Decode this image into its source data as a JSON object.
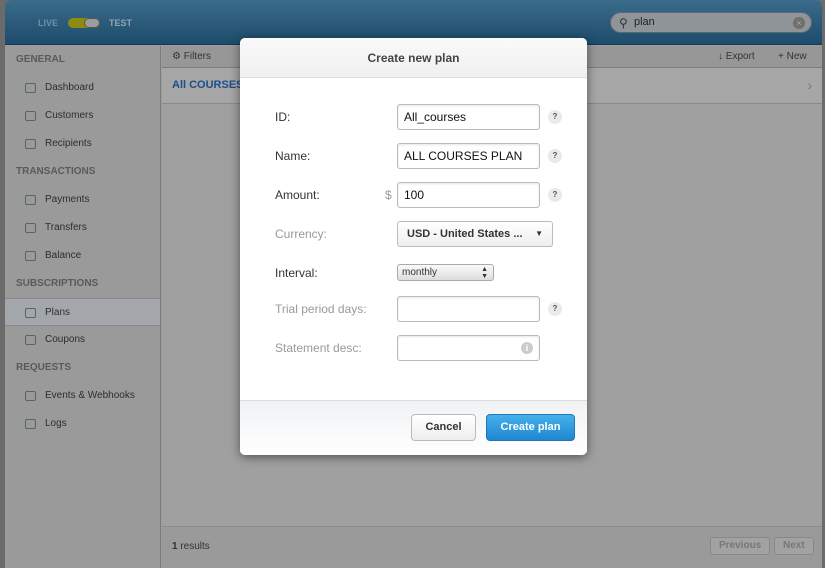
{
  "header": {
    "live_label": "LIVE",
    "test_label": "TEST",
    "mode": "test",
    "search_value": "plan"
  },
  "sidebar": {
    "sections": [
      {
        "title": "GENERAL",
        "items": [
          {
            "label": "Dashboard"
          },
          {
            "label": "Customers"
          },
          {
            "label": "Recipients"
          }
        ]
      },
      {
        "title": "TRANSACTIONS",
        "items": [
          {
            "label": "Payments"
          },
          {
            "label": "Transfers"
          },
          {
            "label": "Balance"
          }
        ]
      },
      {
        "title": "SUBSCRIPTIONS",
        "items": [
          {
            "label": "Plans",
            "active": true
          },
          {
            "label": "Coupons"
          }
        ]
      },
      {
        "title": "REQUESTS",
        "items": [
          {
            "label": "Events & Webhooks"
          },
          {
            "label": "Logs"
          }
        ]
      }
    ]
  },
  "main": {
    "filters": "Filters",
    "export": "Export",
    "new": "New",
    "row_title": "All COURSES",
    "results_count": "1",
    "results_label": "results",
    "previous": "Previous",
    "next": "Next"
  },
  "modal": {
    "title": "Create new plan",
    "id_label": "ID:",
    "id_value": "All_courses",
    "name_label": "Name:",
    "name_value": "ALL COURSES PLAN",
    "amount_label": "Amount:",
    "currency_symbol": "$",
    "amount_value": "100",
    "currency_label": "Currency:",
    "currency_value": "USD - United States ...",
    "interval_label": "Interval:",
    "interval_value": "monthly",
    "trial_label": "Trial period days:",
    "trial_value": "",
    "statement_label": "Statement desc:",
    "statement_value": "",
    "help": "?",
    "info": "i",
    "cancel": "Cancel",
    "create": "Create plan"
  },
  "colors": {
    "primary_button": "#1f87d0",
    "link": "#1b4f8c"
  }
}
